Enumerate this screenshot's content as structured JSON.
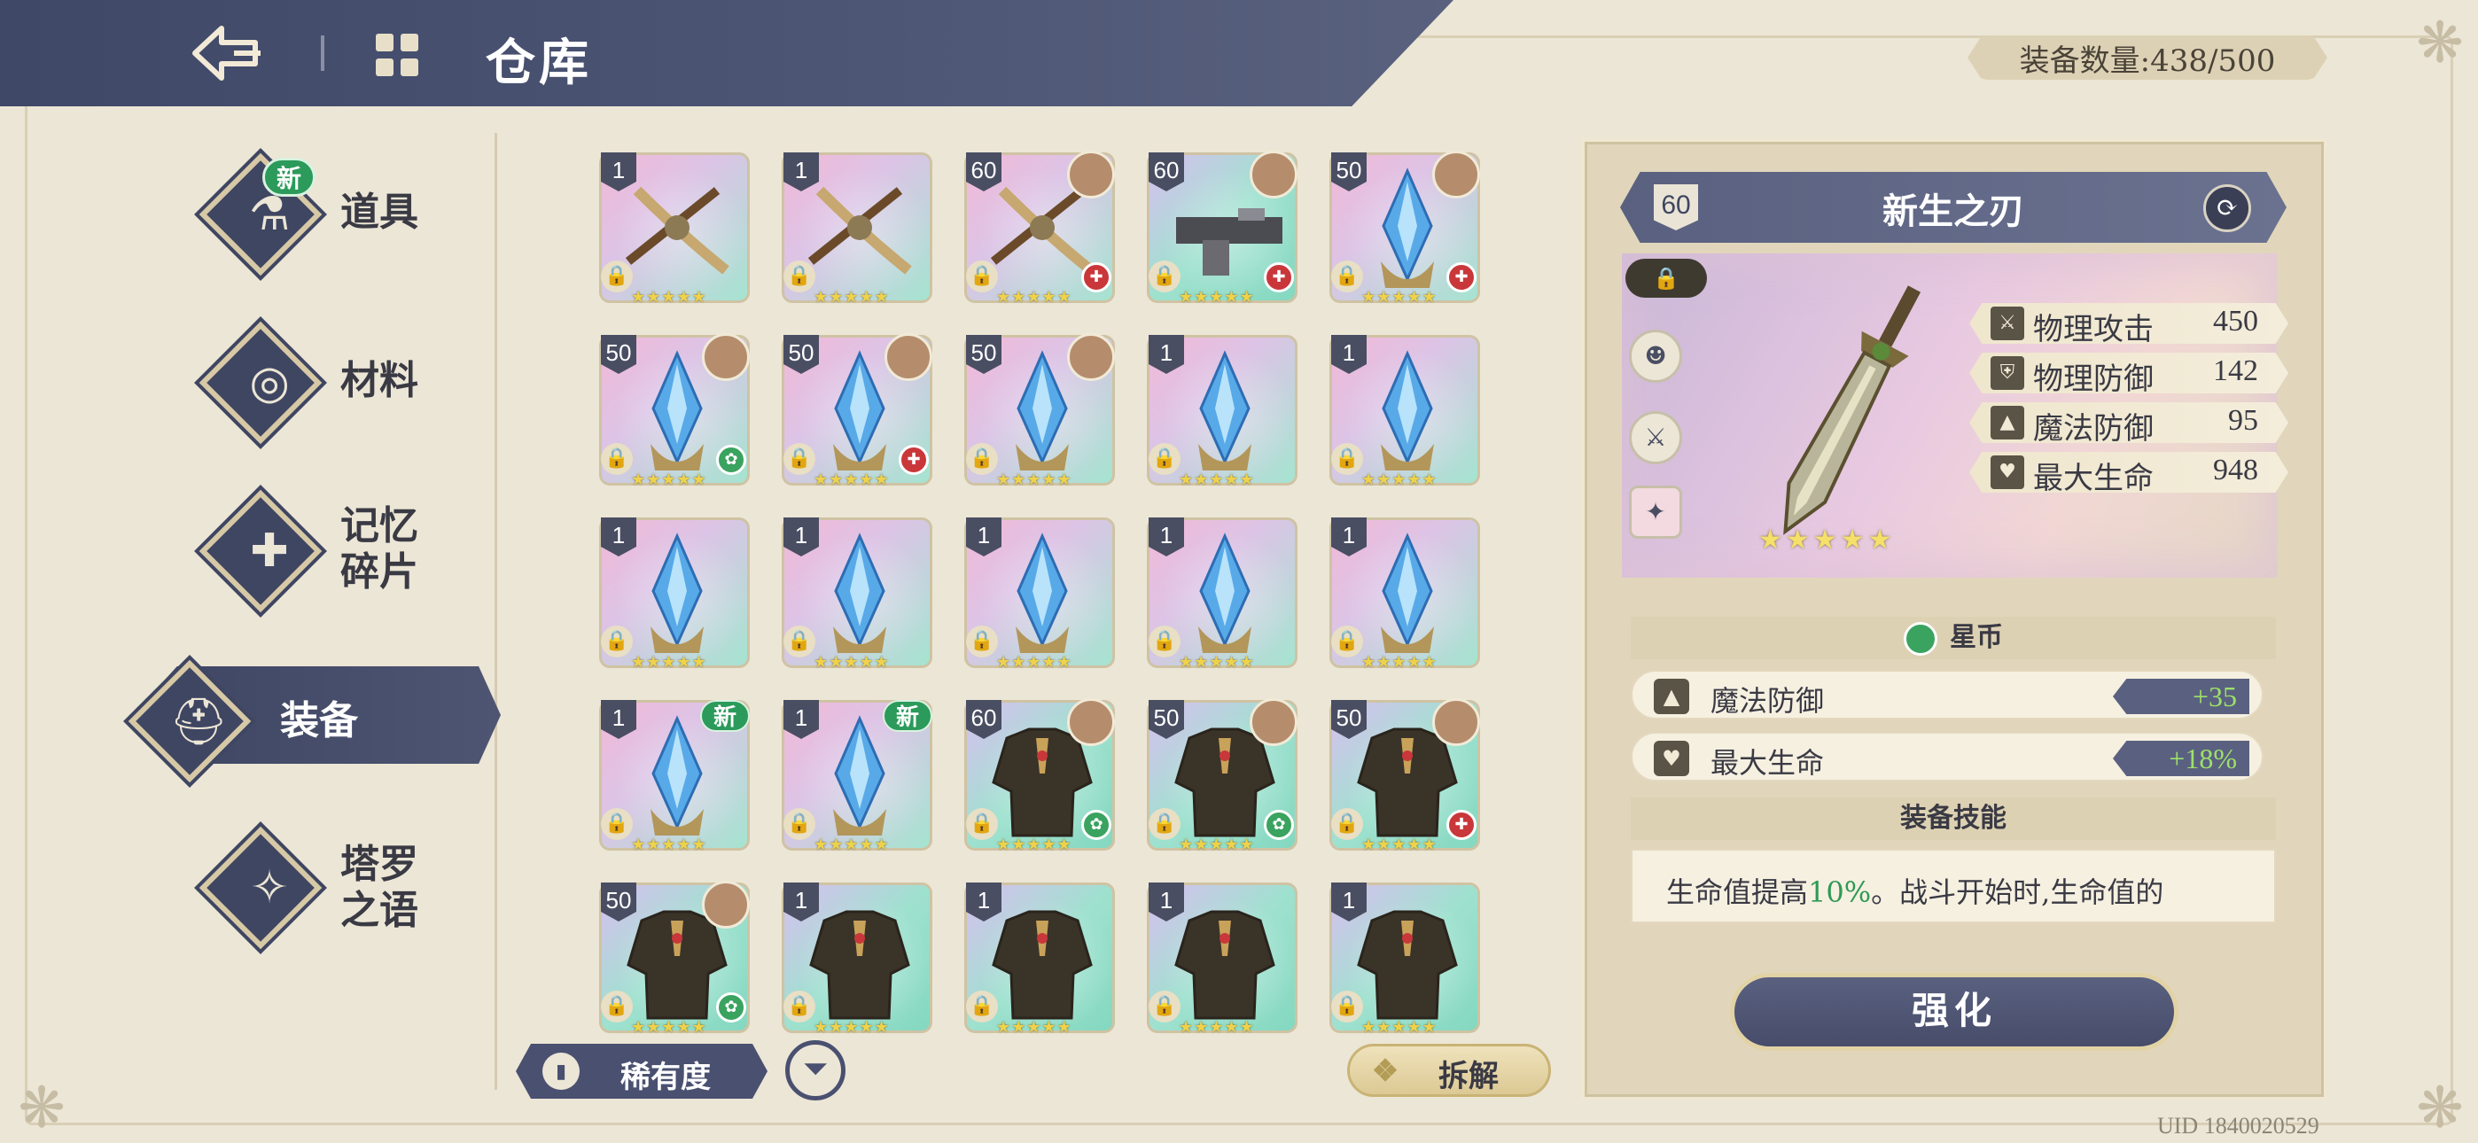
{
  "header": {
    "title": "仓库",
    "equipment_count_label": "装备数量:438/500"
  },
  "sidebar": {
    "items": [
      {
        "label": "道具",
        "badge": "新",
        "icon": "potion-icon",
        "active": false
      },
      {
        "label": "材料",
        "icon": "log-icon",
        "active": false
      },
      {
        "label": "记忆\n碎片",
        "line1": "记忆",
        "line2": "碎片",
        "icon": "puzzle-icon",
        "active": false
      },
      {
        "label": "装备",
        "icon": "helmet-icon",
        "active": true
      },
      {
        "label": "塔罗\n之语",
        "line1": "塔罗",
        "line2": "之语",
        "icon": "tarot-icon",
        "active": false
      }
    ]
  },
  "grid": {
    "rows": [
      [
        {
          "level": "1",
          "item": "crossbow",
          "avatar": false,
          "element": ""
        },
        {
          "level": "1",
          "item": "crossbow",
          "avatar": false,
          "element": ""
        },
        {
          "level": "60",
          "item": "crossbow",
          "avatar": true,
          "element": "red"
        },
        {
          "level": "60",
          "item": "gun",
          "avatar": true,
          "element": "red"
        },
        {
          "level": "50",
          "item": "crystal",
          "avatar": true,
          "element": "red"
        }
      ],
      [
        {
          "level": "50",
          "item": "crystal",
          "avatar": true,
          "element": "green"
        },
        {
          "level": "50",
          "item": "crystal",
          "avatar": true,
          "element": "red"
        },
        {
          "level": "50",
          "item": "crystal",
          "avatar": true,
          "element": ""
        },
        {
          "level": "1",
          "item": "crystal",
          "avatar": false,
          "element": ""
        },
        {
          "level": "1",
          "item": "crystal",
          "avatar": false,
          "element": ""
        }
      ],
      [
        {
          "level": "1",
          "item": "crystal",
          "avatar": false,
          "element": ""
        },
        {
          "level": "1",
          "item": "crystal",
          "avatar": false,
          "element": ""
        },
        {
          "level": "1",
          "item": "crystal",
          "avatar": false,
          "element": ""
        },
        {
          "level": "1",
          "item": "crystal",
          "avatar": false,
          "element": ""
        },
        {
          "level": "1",
          "item": "crystal",
          "avatar": false,
          "element": ""
        }
      ],
      [
        {
          "level": "1",
          "item": "crystal",
          "avatar": false,
          "element": "",
          "new": "新"
        },
        {
          "level": "1",
          "item": "crystal",
          "avatar": false,
          "element": "",
          "new": "新"
        },
        {
          "level": "60",
          "item": "armor",
          "avatar": true,
          "element": "green"
        },
        {
          "level": "50",
          "item": "armor",
          "avatar": true,
          "element": "green"
        },
        {
          "level": "50",
          "item": "armor",
          "avatar": true,
          "element": "red"
        }
      ],
      [
        {
          "level": "50",
          "item": "armor",
          "avatar": true,
          "element": "green"
        },
        {
          "level": "1",
          "item": "armor",
          "avatar": false,
          "element": ""
        },
        {
          "level": "1",
          "item": "armor",
          "avatar": false,
          "element": ""
        },
        {
          "level": "1",
          "item": "armor",
          "avatar": false,
          "element": ""
        },
        {
          "level": "1",
          "item": "armor",
          "avatar": false,
          "element": ""
        }
      ]
    ]
  },
  "bottom": {
    "rarity_label": "稀有度",
    "dismantle_label": "拆解"
  },
  "detail": {
    "level": "60",
    "name": "新生之刃",
    "stars": "★★★★★",
    "stats": [
      {
        "icon": "sword-icon",
        "name": "物理攻击",
        "value": "450"
      },
      {
        "icon": "shield-icon",
        "name": "物理防御",
        "value": "142"
      },
      {
        "icon": "wizard-hat-icon",
        "name": "魔法防御",
        "value": "95"
      },
      {
        "icon": "heart-icon",
        "name": "最大生命",
        "value": "948"
      }
    ],
    "set_name": "星币",
    "bonuses": [
      {
        "icon": "wizard-hat-icon",
        "name": "魔法防御",
        "value": "+35"
      },
      {
        "icon": "heart-icon",
        "name": "最大生命",
        "value": "+18%"
      }
    ],
    "skill_title": "装备技能",
    "skill_text_a": "生命值提高",
    "skill_text_hl": "10%",
    "skill_text_b": "。战斗开始时,生命值的",
    "strengthen_label": "强化"
  },
  "uid": "UID 1840020529",
  "colors": {
    "header": "#454e6c",
    "accent_green": "#2f9a56",
    "bonus_text": "#9ee06a"
  }
}
